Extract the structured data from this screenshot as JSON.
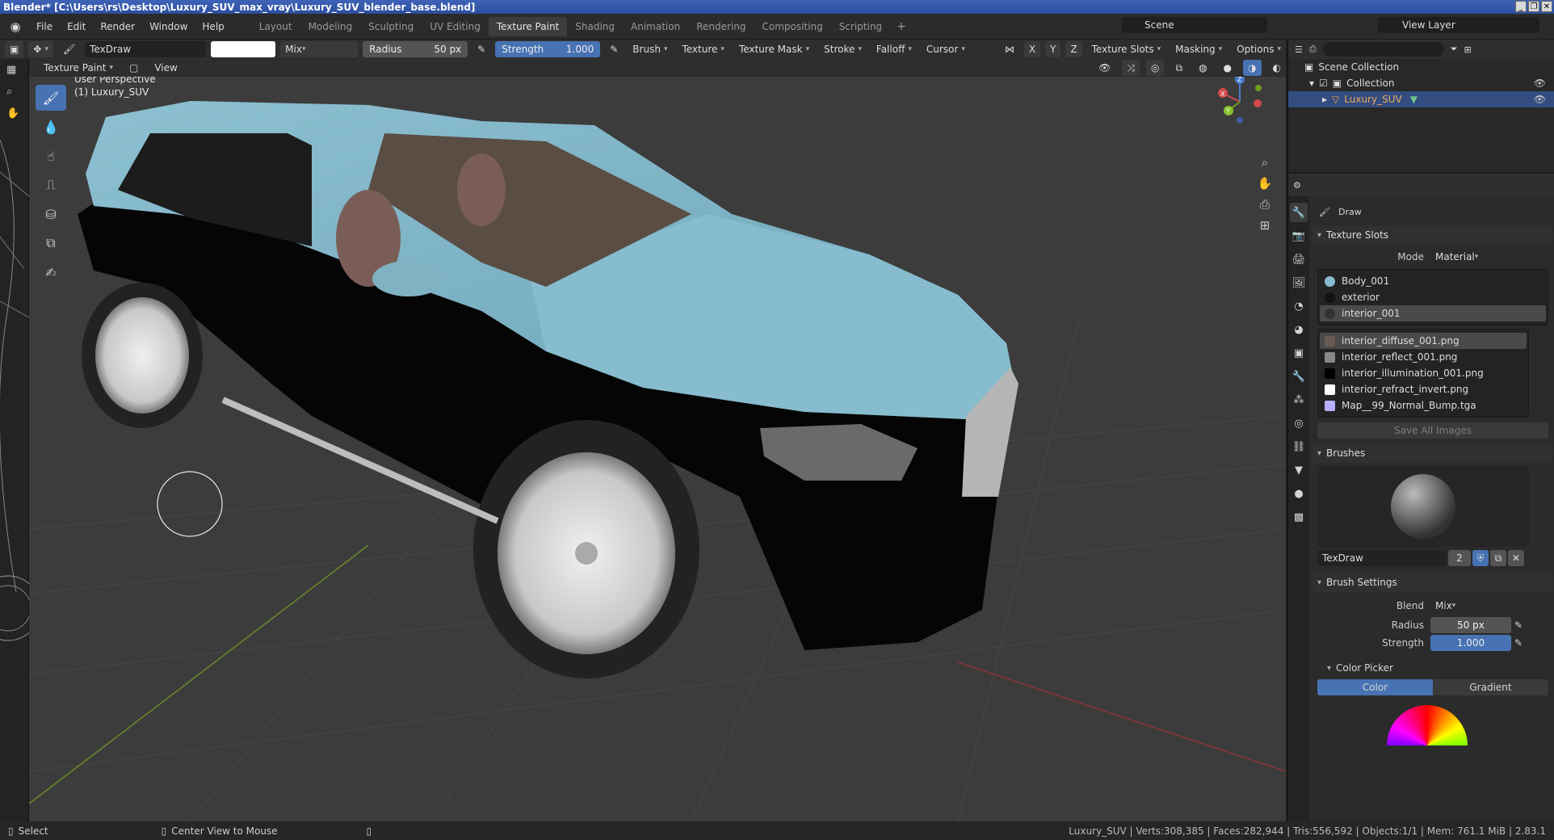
{
  "window": {
    "title": "Blender* [C:\\Users\\rs\\Desktop\\Luxury_SUV_max_vray\\Luxury_SUV_blender_base.blend]",
    "controls": [
      "_",
      "❐",
      "✕"
    ]
  },
  "menu": {
    "items": [
      "File",
      "Edit",
      "Render",
      "Window",
      "Help"
    ]
  },
  "workspaces": {
    "tabs": [
      "Layout",
      "Modeling",
      "Sculpting",
      "UV Editing",
      "Texture Paint",
      "Shading",
      "Animation",
      "Rendering",
      "Compositing",
      "Scripting"
    ],
    "active": "Texture Paint",
    "add": "+"
  },
  "scene": {
    "name": "Scene",
    "view_layer": "View Layer"
  },
  "toolheader": {
    "brush_name": "TexDraw",
    "blend": "Mix",
    "radius_label": "Radius",
    "radius_value": "50 px",
    "strength_label": "Strength",
    "strength_value": "1.000",
    "menus": [
      "Brush",
      "Texture",
      "Texture Mask",
      "Stroke",
      "Falloff",
      "Cursor"
    ],
    "axes": [
      "X",
      "Y",
      "Z"
    ],
    "right_menus": [
      "Texture Slots",
      "Masking",
      "Options"
    ]
  },
  "subheader": {
    "mode": "Texture Paint",
    "view": "View"
  },
  "viewport": {
    "perspective": "User Perspective",
    "object_label": "(1) Luxury_SUV",
    "gizmo_axes": [
      "X",
      "Y",
      "Z"
    ],
    "colors": {
      "body_top": "#7fb3c4",
      "body_bottom": "#050505",
      "grid": "#474747",
      "bg": "#3c3c3c"
    }
  },
  "outliner": {
    "root": "Scene Collection",
    "collection": "Collection",
    "object": "Luxury_SUV"
  },
  "properties": {
    "tool_name": "Draw",
    "texture_slots": {
      "title": "Texture Slots",
      "mode_label": "Mode",
      "mode_value": "Material",
      "materials": [
        "Body_001",
        "exterior",
        "interior_001"
      ],
      "selected_material": "interior_001",
      "images": [
        "interior_diffuse_001.png",
        "interior_reflect_001.png",
        "interior_illumination_001.png",
        "interior_refract_invert.png",
        "Map__99_Normal_Bump.tga"
      ],
      "save_all": "Save All Images"
    },
    "brushes": {
      "title": "Brushes",
      "brush_name": "TexDraw",
      "users": "2"
    },
    "brush_settings": {
      "title": "Brush Settings",
      "blend_label": "Blend",
      "blend_value": "Mix",
      "radius_label": "Radius",
      "radius_value": "50 px",
      "strength_label": "Strength",
      "strength_value": "1.000"
    },
    "color_picker": {
      "title": "Color Picker",
      "tabs": [
        "Color",
        "Gradient"
      ]
    }
  },
  "statusbar": {
    "left": [
      "Select",
      "Center View to Mouse"
    ],
    "right": "Luxury_SUV | Verts:308,385 | Faces:282,944 | Tris:556,592 | Objects:1/1 | Mem: 761.1 MiB | 2.83.1"
  }
}
